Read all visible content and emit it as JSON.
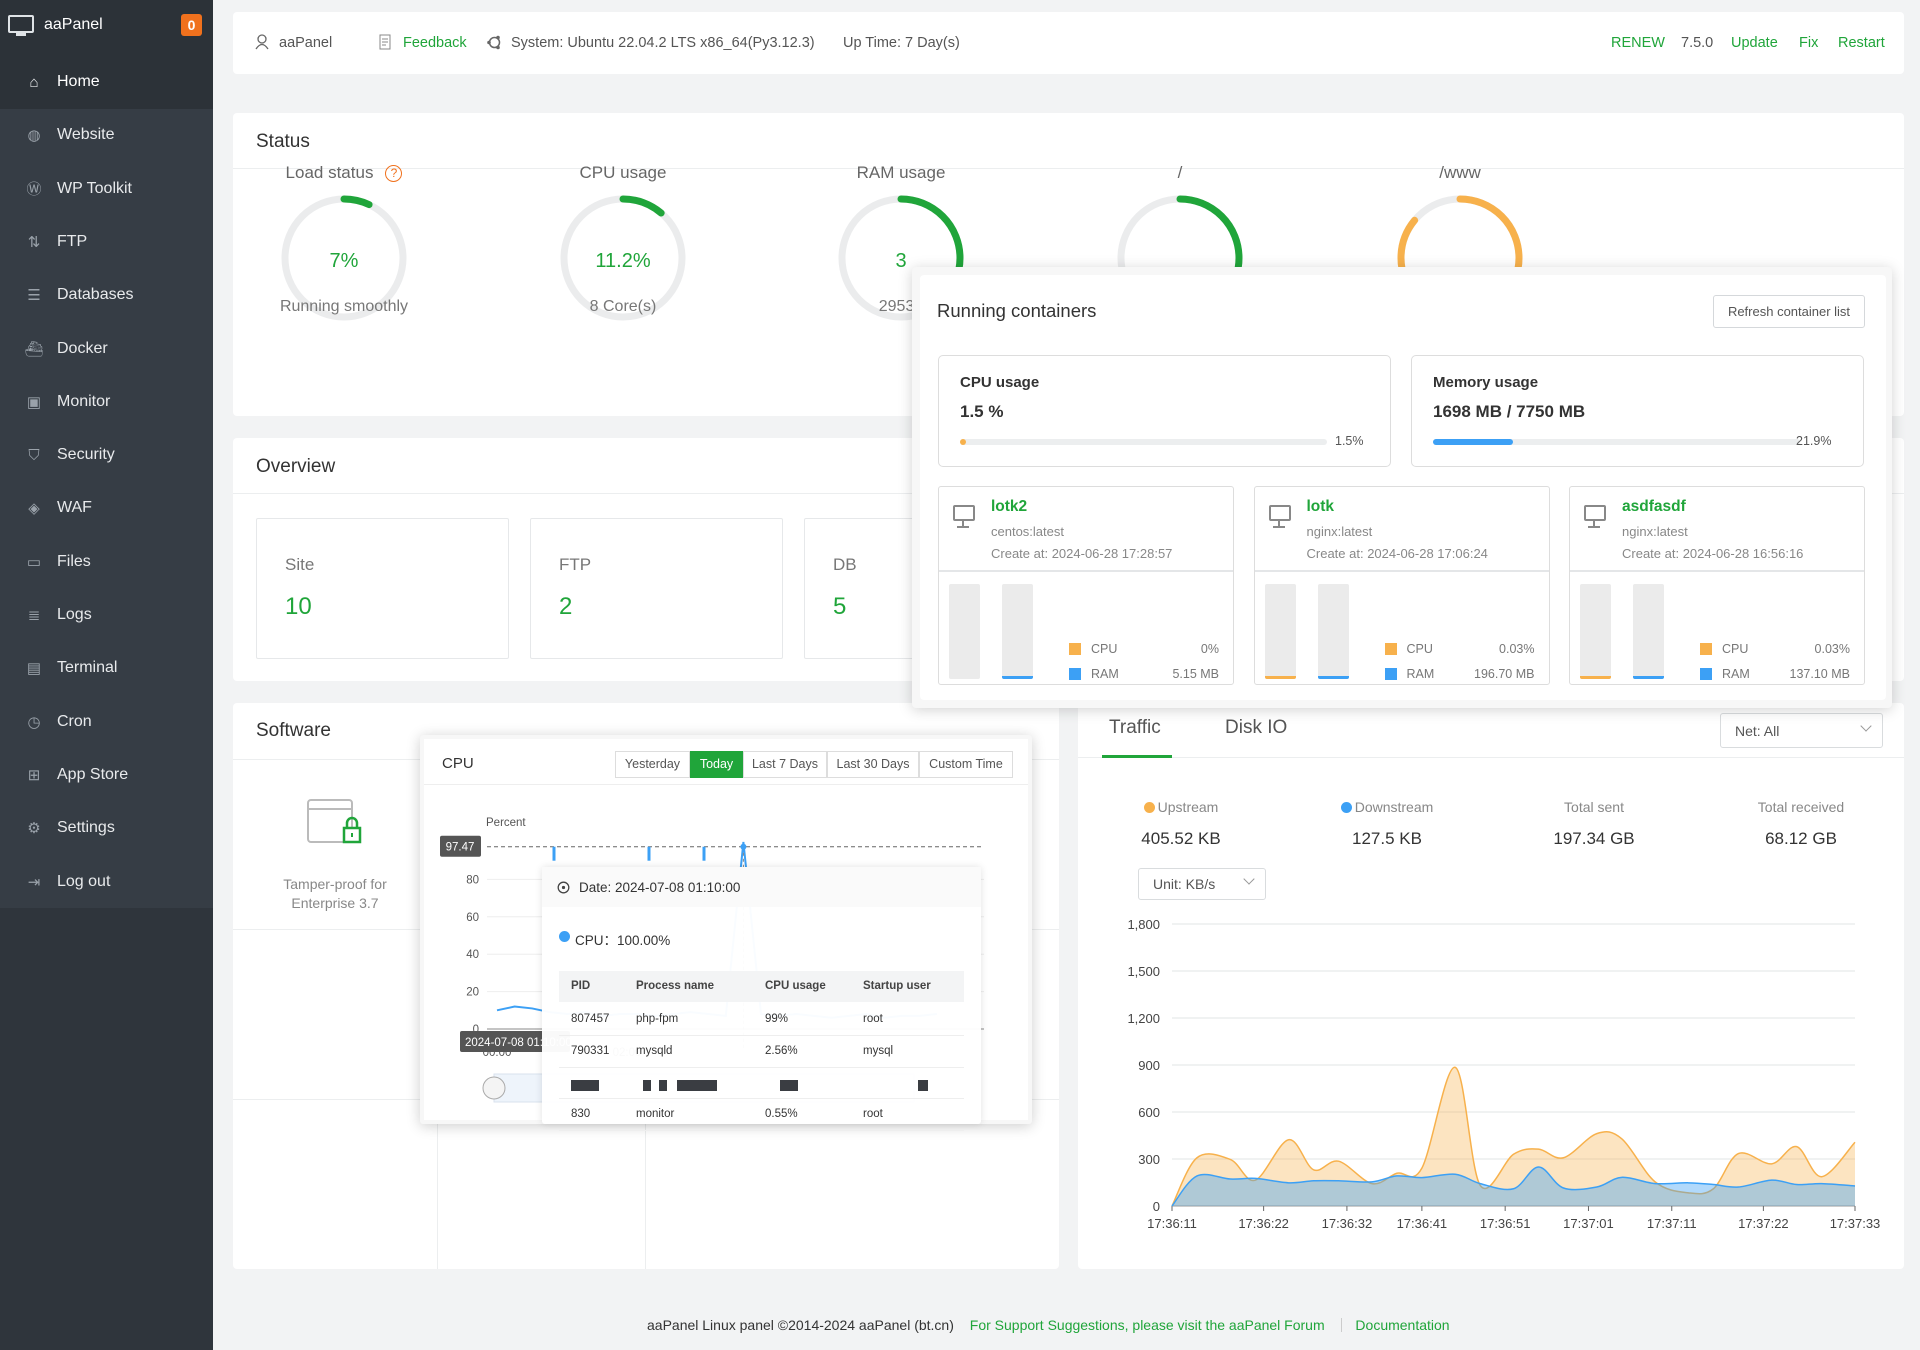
{
  "brand": {
    "name": "aaPanel",
    "badge": "0"
  },
  "sidebar": {
    "items": [
      {
        "label": "Home",
        "icon": "home-icon",
        "glyph": "⌂",
        "active": true
      },
      {
        "label": "Website",
        "icon": "globe-icon",
        "glyph": "◍"
      },
      {
        "label": "WP Toolkit",
        "icon": "wordpress-icon",
        "glyph": "Ⓦ"
      },
      {
        "label": "FTP",
        "icon": "ftp-icon",
        "glyph": "⇅"
      },
      {
        "label": "Databases",
        "icon": "database-icon",
        "glyph": "☰"
      },
      {
        "label": "Docker",
        "icon": "docker-icon",
        "glyph": "⛴"
      },
      {
        "label": "Monitor",
        "icon": "monitor-icon",
        "glyph": "▣"
      },
      {
        "label": "Security",
        "icon": "shield-icon",
        "glyph": "⛉"
      },
      {
        "label": "WAF",
        "icon": "waf-shield-icon",
        "glyph": "◈"
      },
      {
        "label": "Files",
        "icon": "folder-icon",
        "glyph": "▭"
      },
      {
        "label": "Logs",
        "icon": "logs-icon",
        "glyph": "≣"
      },
      {
        "label": "Terminal",
        "icon": "terminal-icon",
        "glyph": "▤"
      },
      {
        "label": "Cron",
        "icon": "clock-icon",
        "glyph": "◷"
      },
      {
        "label": "App Store",
        "icon": "grid-icon",
        "glyph": "⊞"
      },
      {
        "label": "Settings",
        "icon": "gear-icon",
        "glyph": "⚙"
      },
      {
        "label": "Log out",
        "icon": "logout-icon",
        "glyph": "⇥"
      }
    ]
  },
  "header": {
    "user": "aaPanel",
    "feedback": "Feedback",
    "system": "System: Ubuntu 22.04.2 LTS x86_64(Py3.12.3)",
    "uptime": "Up Time: 7 Day(s)",
    "renew": "RENEW",
    "version": "7.5.0",
    "update": "Update",
    "fix": "Fix",
    "restart": "Restart"
  },
  "status": {
    "title": "Status",
    "gauges": [
      {
        "title": "Load status",
        "value": "7%",
        "percent": 7,
        "sub": "Running smoothly",
        "color": "#20a53a",
        "help": "?"
      },
      {
        "title": "CPU usage",
        "value": "11.2%",
        "percent": 11.2,
        "sub": "8 Core(s)",
        "color": "#20a53a"
      },
      {
        "title": "RAM usage",
        "value": "3",
        "percent": 38,
        "sub": "2953 /",
        "color": "#20a53a"
      },
      {
        "title": "/",
        "percent": 30,
        "color": "#20a53a"
      },
      {
        "title": "/www",
        "percent": 86,
        "color": "#f7b14c"
      }
    ]
  },
  "overview": {
    "title": "Overview",
    "cards": [
      {
        "label": "Site",
        "value": "10"
      },
      {
        "label": "FTP",
        "value": "2"
      },
      {
        "label": "DB",
        "value": "5"
      }
    ]
  },
  "software": {
    "title": "Software",
    "items": [
      {
        "label1": "Tamper-proof for",
        "label2": "Enterprise 3.7"
      }
    ]
  },
  "traffic": {
    "tabs": [
      "Traffic",
      "Disk IO"
    ],
    "net_select": "Net: All",
    "unit_select": "Unit: KB/s",
    "stats": [
      {
        "label": "Upstream",
        "value": "405.52 KB",
        "color": "#f7b14c"
      },
      {
        "label": "Downstream",
        "value": "127.5 KB",
        "color": "#3ca0f5"
      },
      {
        "label": "Total sent",
        "value": "197.34 GB"
      },
      {
        "label": "Total received",
        "value": "68.12 GB"
      }
    ]
  },
  "containers": {
    "title": "Running containers",
    "refresh": "Refresh container list",
    "cpu": {
      "label": "CPU usage",
      "value": "1.5 %",
      "percent_label": "1.5%",
      "percent": 1.5,
      "color": "#f7b14c"
    },
    "memory": {
      "label": "Memory usage",
      "value": "1698 MB / 7750 MB",
      "percent_label": "21.9%",
      "percent": 21.9,
      "color": "#3ca0f5"
    },
    "list": [
      {
        "name": "lotk2",
        "image": "centos:latest",
        "created": "Create at: 2024-06-28 17:28:57",
        "cpu": "0%",
        "ram": "5.15 MB",
        "cpu_pct": 0,
        "ram_pct": 1
      },
      {
        "name": "lotk",
        "image": "nginx:latest",
        "created": "Create at: 2024-06-28 17:06:24",
        "cpu": "0.03%",
        "ram": "196.70 MB",
        "cpu_pct": 0.03,
        "ram_pct": 2.5
      },
      {
        "name": "asdfasdf",
        "image": "nginx:latest",
        "created": "Create at: 2024-06-28 16:56:16",
        "cpu": "0.03%",
        "ram": "137.10 MB",
        "cpu_pct": 0.03,
        "ram_pct": 1.8
      }
    ],
    "legend_cpu": "CPU",
    "legend_ram": "RAM"
  },
  "cpu_popup": {
    "title": "CPU",
    "ranges": [
      "Yesterday",
      "Today",
      "Last 7 Days",
      "Last 30 Days",
      "Custom Time"
    ],
    "active_range": "Today",
    "axis_pointer_value": "97.47",
    "axis_pointer_time": "2024-07-08 01:10:00",
    "tooltip": {
      "date": "Date: 2024-07-08 01:10:00",
      "series": "CPU：100.00%",
      "columns": [
        "PID",
        "Process name",
        "CPU usage",
        "Startup user"
      ],
      "rows": [
        [
          "807457",
          "php-fpm",
          "99%",
          "root"
        ],
        [
          "790331",
          "mysqld",
          "2.56%",
          "mysql"
        ],
        null,
        [
          "830",
          "monitor",
          "0.55%",
          "root"
        ]
      ]
    }
  },
  "footer": {
    "copyright": "aaPanel Linux panel ©2014-2024 aaPanel (bt.cn)",
    "support": "For Support Suggestions, please visit the aaPanel Forum",
    "docs": "Documentation"
  },
  "chart_data": [
    {
      "type": "area",
      "title": "",
      "ylabel": "",
      "xlabel": "",
      "ylim": [
        0,
        1800
      ],
      "yticks": [
        0,
        300,
        600,
        900,
        1200,
        1500,
        1800
      ],
      "xticks": [
        "17:36:11",
        "17:36:22",
        "17:36:32",
        "17:36:41",
        "17:36:51",
        "17:37:01",
        "17:37:11",
        "17:37:22",
        "17:37:33"
      ],
      "grid": true,
      "x": [
        "17:36:11",
        "17:36:14",
        "17:36:18",
        "17:36:21",
        "17:36:25",
        "17:36:28",
        "17:36:31",
        "17:36:35",
        "17:36:38",
        "17:36:41",
        "17:36:45",
        "17:36:48",
        "17:36:52",
        "17:36:55",
        "17:36:58",
        "17:37:02",
        "17:37:05",
        "17:37:09",
        "17:37:13",
        "17:37:16",
        "17:37:19",
        "17:37:23",
        "17:37:26",
        "17:37:29",
        "17:37:33"
      ],
      "series": [
        {
          "name": "Upstream",
          "color": "#f7b14c",
          "values": [
            0,
            308,
            297,
            165,
            423,
            231,
            286,
            143,
            209,
            242,
            885,
            132,
            330,
            363,
            308,
            462,
            429,
            154,
            84,
            110,
            335,
            269,
            379,
            187,
            407
          ]
        },
        {
          "name": "Downstream",
          "color": "#3ca0f5",
          "values": [
            0,
            192,
            172,
            176,
            148,
            161,
            161,
            154,
            192,
            181,
            203,
            143,
            110,
            249,
            115,
            121,
            183,
            143,
            148,
            137,
            121,
            165,
            137,
            143,
            128
          ]
        }
      ]
    },
    {
      "type": "line",
      "title": "",
      "ylabel": "Percent",
      "ylim": [
        0,
        100
      ],
      "yticks": [
        0,
        20,
        40,
        60,
        80
      ],
      "xticks": [
        "00:00",
        "02:00"
      ],
      "x": [
        "00:00",
        "00:05",
        "00:10",
        "00:15",
        "00:20",
        "00:25",
        "00:30",
        "00:35",
        "00:40",
        "00:45",
        "00:50",
        "00:55",
        "01:00",
        "01:05",
        "01:10",
        "01:15",
        "01:20",
        "01:25",
        "01:30",
        "01:35",
        "01:40",
        "01:45",
        "01:50",
        "01:55",
        "02:00",
        "02:05"
      ],
      "series": [
        {
          "name": "CPU",
          "color": "#3ca0f5",
          "values": [
            10,
            12,
            11,
            9,
            8,
            9,
            7,
            8,
            8,
            7,
            8,
            9,
            8,
            7,
            100,
            8,
            7,
            8,
            7,
            6,
            7,
            8,
            6,
            7,
            7,
            8
          ]
        }
      ]
    }
  ]
}
